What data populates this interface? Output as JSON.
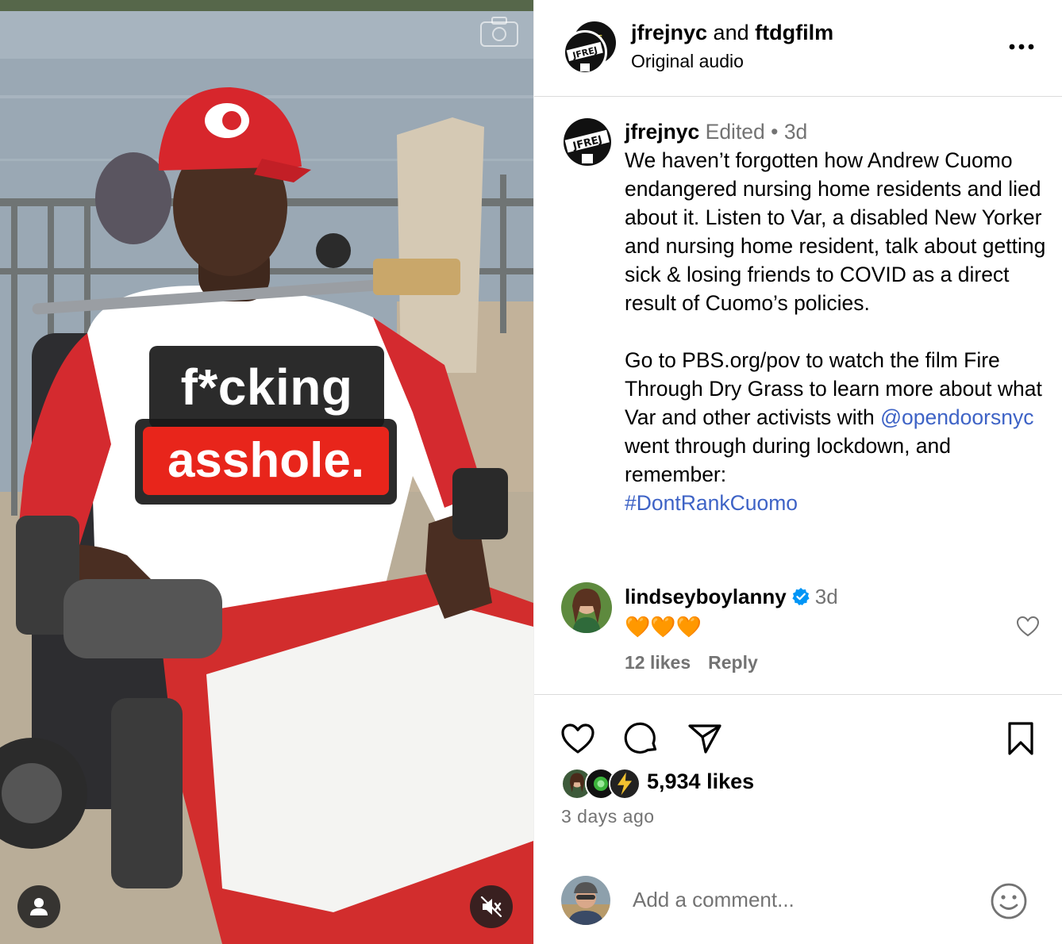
{
  "media": {
    "caption_line1": "f*cking",
    "caption_line2": "asshole.",
    "icons": [
      "camera-icon",
      "user-tag-icon",
      "muted-speaker-icon"
    ],
    "colors": {
      "caption_bg": "#191919",
      "caption_red": "#e8251b"
    }
  },
  "header": {
    "user1": "jfrejnyc",
    "and": " and ",
    "user2": "ftdgfilm",
    "audio": "Original audio"
  },
  "post": {
    "username": "jfrejnyc",
    "edited": "Edited",
    "separator": "•",
    "time": "3d",
    "text_p1": "We haven’t forgotten how Andrew Cuomo endangered nursing home residents and lied about it. Listen to Var, a disabled New Yorker and nursing home resident, talk about getting sick & losing friends to COVID as a direct result of Cuomo’s policies.",
    "text_p2_a": "Go to PBS.org/pov to watch the film Fire Through Dry Grass to learn more about what Var and other activists with ",
    "mention": "@opendoorsnyc",
    "text_p2_b": " went through during lockdown, and remember:",
    "hashtag": "#DontRankCuomo"
  },
  "comment": {
    "username": "lindseyboylanny",
    "time": "3d",
    "text": "🧡🧡🧡",
    "likes": "12 likes",
    "reply": "Reply"
  },
  "engagement": {
    "likes": "5,934 likes",
    "ago": "3 days ago"
  },
  "composer": {
    "placeholder": "Add a comment..."
  },
  "colors": {
    "link": "#3e63c6",
    "secondary_text": "#737373",
    "verified": "#0095f6",
    "divider": "#dbdbdb"
  }
}
